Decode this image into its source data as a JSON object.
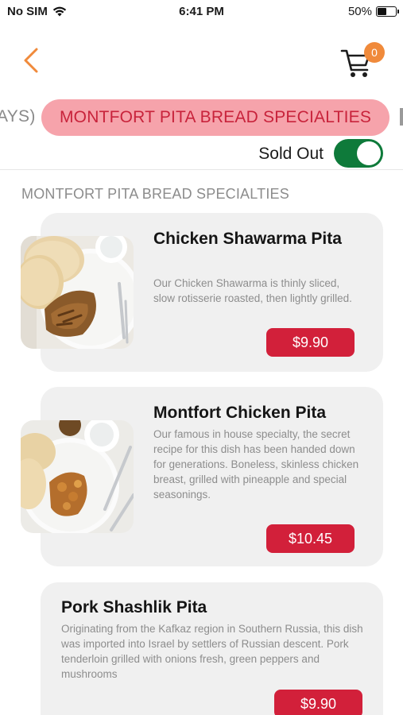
{
  "status_bar": {
    "carrier": "No SIM",
    "time": "6:41 PM",
    "battery": "50%",
    "battery_level": 0.5
  },
  "header": {
    "back_icon": "chevron-left-icon",
    "cart_icon": "shopping-cart-icon",
    "cart_count": "0",
    "accent_color": "#f08a3b"
  },
  "tabs": {
    "previous": "AYS)",
    "active": "MONTFORT PITA BREAD SPECIALTIES"
  },
  "filter": {
    "sold_out_label": "Sold Out",
    "sold_out_enabled": true,
    "toggle_color": "#0e7a3a"
  },
  "section": {
    "title": "MONTFORT PITA BREAD SPECIALTIES"
  },
  "items": [
    {
      "name": "Chicken Shawarma Pita",
      "description": "Our Chicken Shawarma is thinly sliced, slow rotisserie roasted, then lightly grilled.",
      "price": "$9.90"
    },
    {
      "name": "Montfort Chicken Pita",
      "description": "Our famous in house specialty, the secret recipe for this dish has been handed down for generations. Boneless, skinless chicken breast, grilled with pineapple and special seasonings.",
      "price": "$10.45"
    },
    {
      "name": "Pork Shashlik Pita",
      "description": "Originating from the Kafkaz region in Southern Russia, this dish was imported into Israel by settlers of Russian descent. Pork tenderloin grilled with onions fresh, green peppers and mushrooms",
      "price": "$9.90"
    }
  ],
  "colors": {
    "price_button": "#d2203a",
    "active_tab_bg": "#f6a3ab",
    "active_tab_text": "#c8233b"
  }
}
